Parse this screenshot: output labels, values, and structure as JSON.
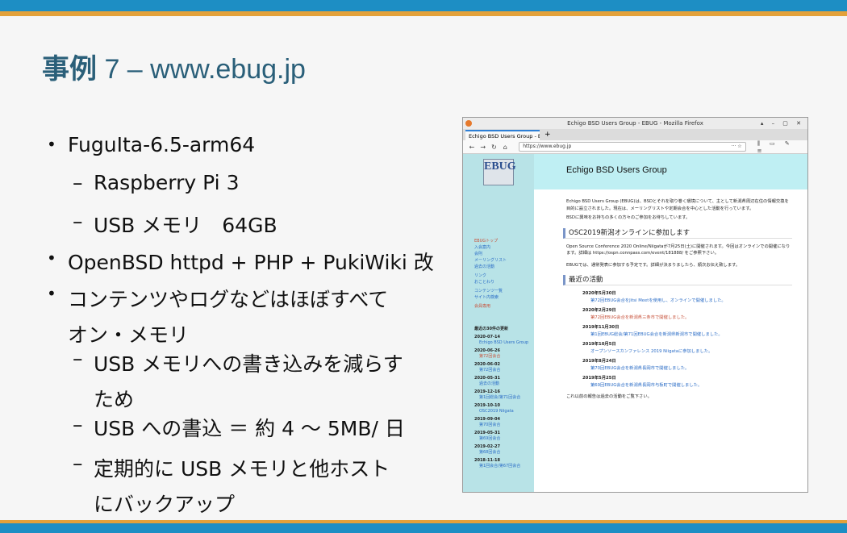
{
  "slide": {
    "title_ja": "事例",
    "title_rest": " 7 – www.ebug.jp",
    "bullets": [
      {
        "level": 1,
        "text": "FuguIta-6.5-arm64"
      },
      {
        "level": 2,
        "text": "Raspberry Pi 3"
      },
      {
        "level": 2,
        "text": "USB メモリ　64GB"
      },
      {
        "level": 1,
        "text": "OpenBSD httpd + PHP + PukiWiki 改"
      },
      {
        "level": 1,
        "text": "コンテンツやログなどはほぼすべてオン・メモリ"
      },
      {
        "level": 2,
        "text": "USB メモリへの書き込みを減らすため"
      },
      {
        "level": 2,
        "text": "USB への書込 ＝ 約 4 〜 5MB/ 日"
      },
      {
        "level": 2,
        "text": "定期的に USB メモリと他ホストにバックアップ"
      }
    ]
  },
  "browser": {
    "window_title": "Echigo BSD Users Group - EBUG - Mozilla Firefox",
    "tab_label": "Echigo BSD Users Group - E",
    "url": "https://www.ebug.jp",
    "logo_text": "EBUG",
    "header": "Echigo BSD Users Group",
    "sidebar_links": [
      "EBUGトップ",
      "入会案内",
      "会則",
      "メーリングリスト",
      "過去の活動",
      "リンク",
      "おことわり",
      "コンテンツ一覧",
      "サイト内検索",
      "会員専用"
    ],
    "recent_heading": "最近の30件の更新",
    "recent": [
      {
        "date": "2020-07-14",
        "item": "Echigo BSD Users Group"
      },
      {
        "date": "2020-06-26",
        "item": "第72回会合"
      },
      {
        "date": "2020-06-02",
        "item": "第72回会合"
      },
      {
        "date": "2020-05-31",
        "item": "過去の活動"
      },
      {
        "date": "2019-12-16",
        "item": "第1回総会/第71回会合"
      },
      {
        "date": "2019-10-10",
        "item": "OSC2019 Niigata"
      },
      {
        "date": "2019-09-04",
        "item": "第70回会合"
      },
      {
        "date": "2019-05-31",
        "item": "第69回会合"
      },
      {
        "date": "2019-02-27",
        "item": "第68回会合"
      },
      {
        "date": "2018-11-18",
        "item": "第1回会合/第67回会合"
      }
    ],
    "intro": "Echigo BSD Users Group (EBUG)は、BSDとそれを取り巻く環境について、主として新潟県周辺在住の情報交換を目的に設立されました。現在は、メーリングリストや定期会合を中心とした活動を行っています。",
    "intro2": "BSDに興味をお持ちの多くの方々のご参加をお待ちしています。",
    "section1": "OSC2019新潟オンラインに参加します",
    "osc_text": "Open Source Conference 2020 Online/Niigataが7月25日(土)に開催されます。今回はオンラインでの開催になります。詳細は https://ospn.connpass.com/event/181888/ をご参照下さい。",
    "osc_text2": "EBUGでは、通常発表に参加する予定です。詳細が決まりましたら、順次お伝え致します。",
    "section2": "最近の活動",
    "activities": [
      {
        "date": "2020年5月30日",
        "text": "第72回EBUG会合をJitsi Meetを使用し、オンラインで開催しました。"
      },
      {
        "date": "2020年2月29日",
        "text": "第72回EBUG会合を新潟県三条市で開催しました。"
      },
      {
        "date": "2019年11月30日",
        "text": "第1回EBUG総会/第71回EBUG会合を新潟県新潟市で開催しました。"
      },
      {
        "date": "2019年10月5日",
        "text": "オープンソースカンファレンス 2019 Niigataに参加しました。"
      },
      {
        "date": "2019年8月24日",
        "text": "第70回EBUG会合を新潟県長岡市で開催しました。"
      },
      {
        "date": "2019年5月25日",
        "text": "第69回EBUG会合を新潟県長岡市与板町で開催しました。"
      }
    ],
    "footer": "これ以前の報告は過去の活動をご覧下さい。"
  }
}
